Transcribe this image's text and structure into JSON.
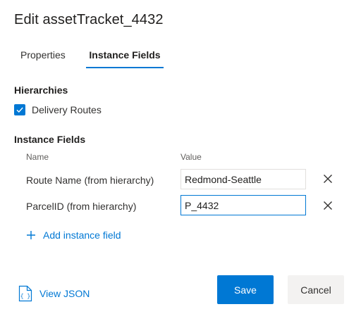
{
  "dialog": {
    "title": "Edit assetTracket_4432"
  },
  "tabs": [
    {
      "label": "Properties",
      "selected": false
    },
    {
      "label": "Instance Fields",
      "selected": true
    }
  ],
  "hierarchies": {
    "label": "Hierarchies",
    "items": [
      {
        "label": "Delivery Routes",
        "checked": true
      }
    ]
  },
  "instance_fields": {
    "label": "Instance Fields",
    "col_name": "Name",
    "col_value": "Value",
    "rows": [
      {
        "name": "Route Name (from hierarchy)",
        "value": "Redmond-Seattle"
      },
      {
        "name": "ParcelID (from hierarchy)",
        "value": "P_4432"
      }
    ],
    "add_label": "Add instance field"
  },
  "footer": {
    "view_json_label": "View JSON",
    "save_label": "Save",
    "cancel_label": "Cancel"
  },
  "colors": {
    "accent": "#0078d4",
    "text": "#323130",
    "secondary_button": "#f3f2f1"
  },
  "icons": [
    "checkmark-icon",
    "close-icon",
    "add-icon",
    "json-file-icon"
  ]
}
